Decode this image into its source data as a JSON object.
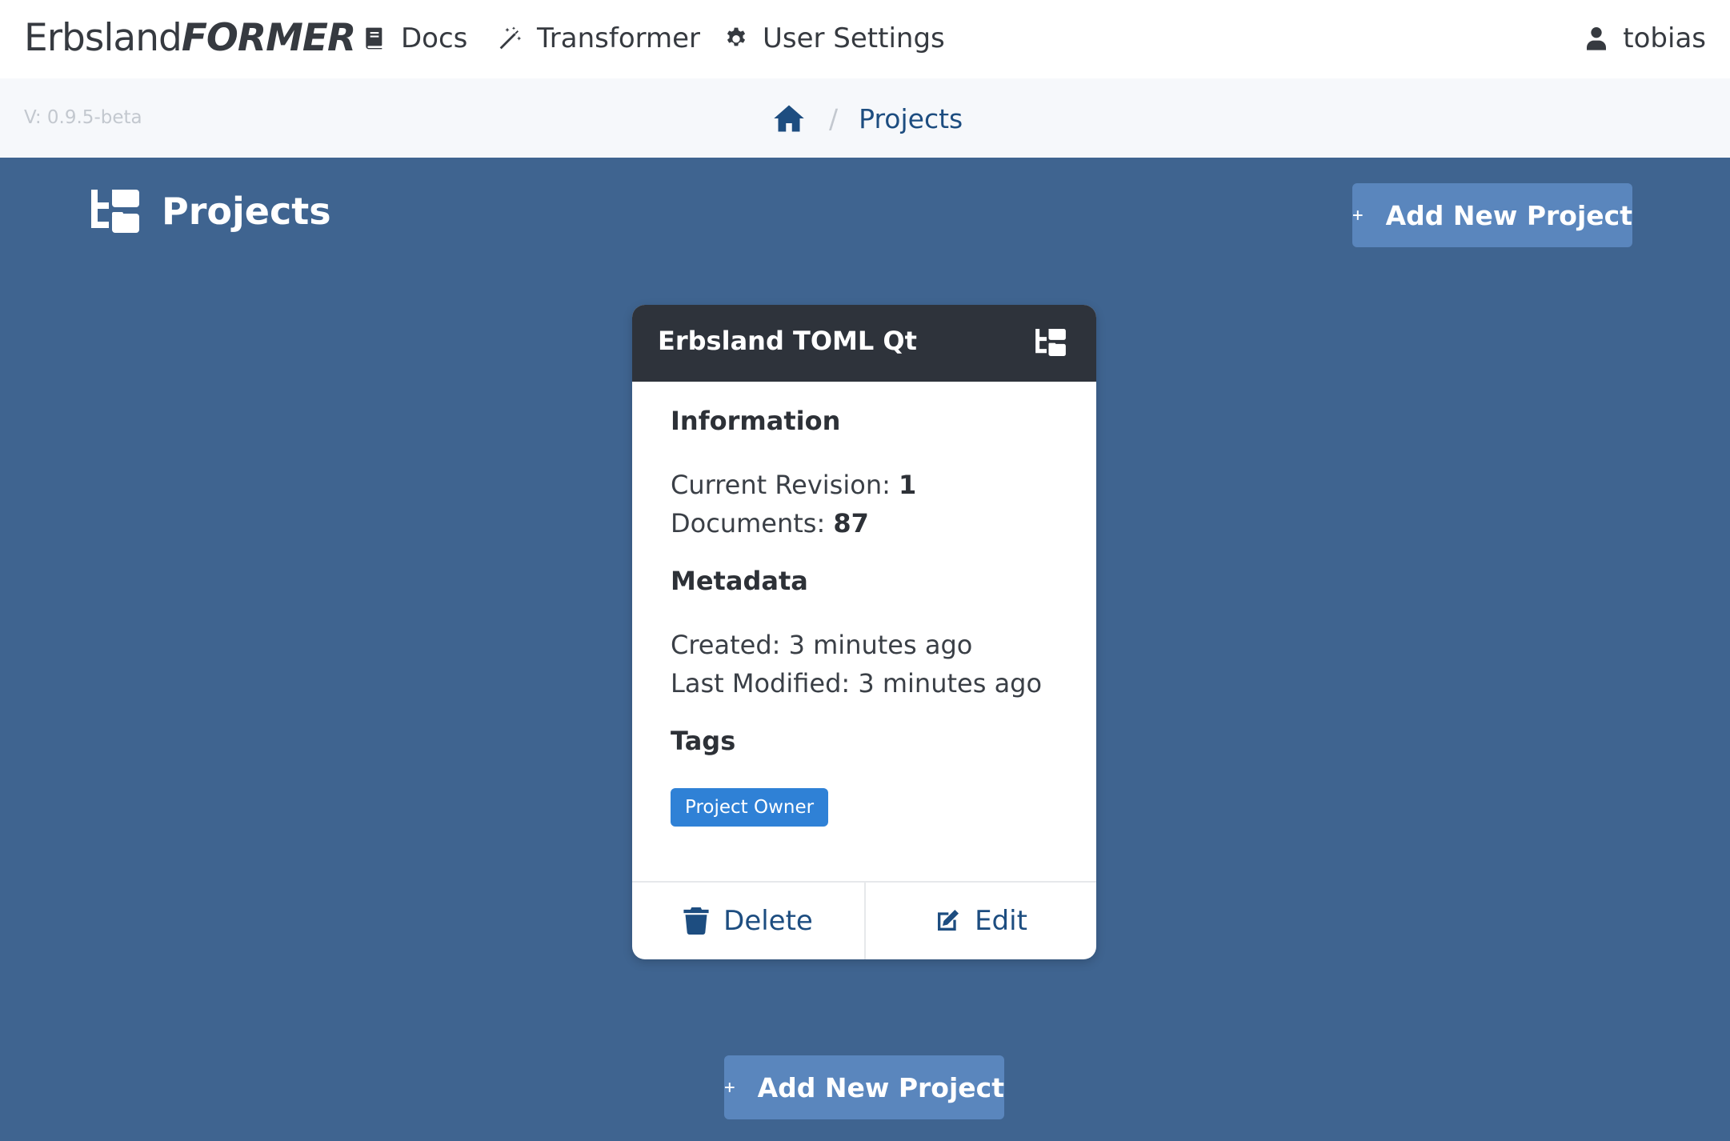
{
  "navbar": {
    "brand_light": "Erbsland",
    "brand_bold": "FORMER",
    "items": [
      {
        "label": "Docs",
        "icon": "book-icon"
      },
      {
        "label": "Transformer",
        "icon": "magic-wand-icon"
      },
      {
        "label": "User Settings",
        "icon": "gear-icon"
      }
    ],
    "user": {
      "label": "tobias",
      "icon": "user-icon"
    }
  },
  "crumbbar": {
    "version": "V: 0.9.5-beta",
    "separator": "/",
    "current": "Projects"
  },
  "header": {
    "title": "Projects",
    "add_button_label": "Add New Project"
  },
  "card": {
    "title": "Erbsland TOML Qt",
    "information_heading": "Information",
    "current_revision_label": "Current Revision:",
    "current_revision_value": "1",
    "documents_label": "Documents:",
    "documents_value": "87",
    "metadata_heading": "Metadata",
    "created": "Created: 3 minutes ago",
    "last_modified": "Last Modified: 3 minutes ago",
    "tags_heading": "Tags",
    "tags": [
      "Project Owner"
    ],
    "delete_label": "Delete",
    "edit_label": "Edit"
  },
  "footer": {
    "add_button_label": "Add New Project"
  },
  "colors": {
    "page_background": "#3f6490",
    "primary_button": "#5a86bd",
    "card_header": "#2e333b",
    "badge": "#2f81d6",
    "link": "#1d4d80"
  }
}
